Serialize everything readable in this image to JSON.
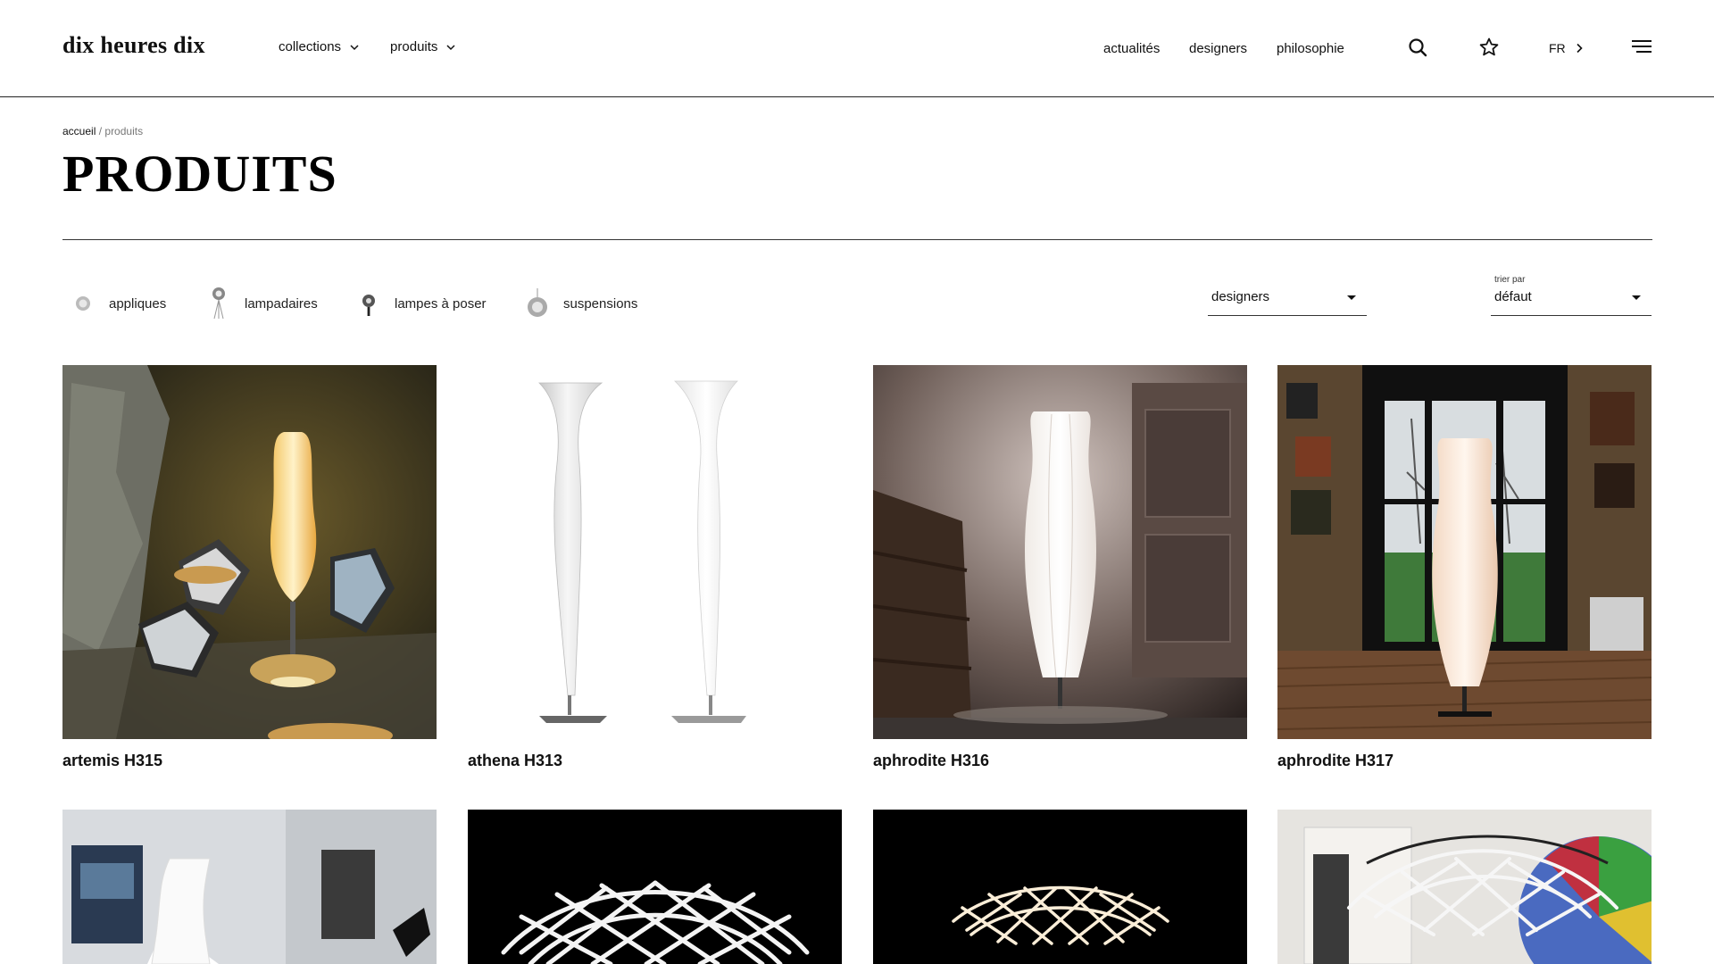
{
  "header": {
    "logo": "dix heures dix",
    "nav_left": [
      {
        "label": "collections"
      },
      {
        "label": "produits"
      }
    ],
    "nav_right": [
      {
        "label": "actualités"
      },
      {
        "label": "designers"
      },
      {
        "label": "philosophie"
      }
    ],
    "icons": [
      "search-icon",
      "star-icon",
      "hamburger-menu-icon"
    ],
    "language": "FR"
  },
  "breadcrumb": {
    "home": "accueil",
    "separator": "/",
    "current": "produits"
  },
  "page_title": "PRODUITS",
  "filters": {
    "categories": [
      {
        "label": "appliques",
        "icon": "wall-lamp-icon"
      },
      {
        "label": "lampadaires",
        "icon": "floor-lamp-icon"
      },
      {
        "label": "lampes à poser",
        "icon": "table-lamp-icon"
      },
      {
        "label": "suspensions",
        "icon": "pendant-lamp-icon"
      }
    ],
    "designer_select": {
      "value": "designers"
    },
    "sort_select": {
      "label": "trier par",
      "value": "défaut"
    }
  },
  "products": [
    {
      "name": "artemis H315"
    },
    {
      "name": "athena H313"
    },
    {
      "name": "aphrodite H316"
    },
    {
      "name": "aphrodite H317"
    },
    {
      "name": ""
    },
    {
      "name": ""
    },
    {
      "name": ""
    },
    {
      "name": ""
    }
  ],
  "colors": {
    "text": "#111111",
    "rule": "#333333",
    "muted": "#777777",
    "background": "#ffffff"
  }
}
